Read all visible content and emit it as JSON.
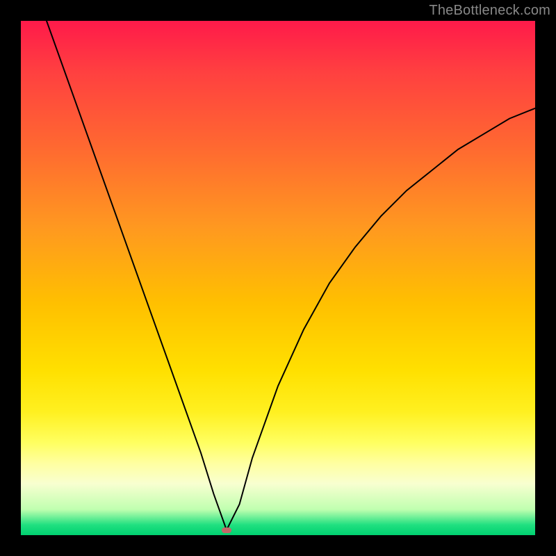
{
  "watermark": "TheBottleneck.com",
  "chart_data": {
    "type": "line",
    "title": "",
    "xlabel": "",
    "ylabel": "",
    "x": [
      0.05,
      0.1,
      0.15,
      0.2,
      0.25,
      0.3,
      0.35,
      0.375,
      0.4,
      0.425,
      0.45,
      0.5,
      0.55,
      0.6,
      0.65,
      0.7,
      0.75,
      0.8,
      0.85,
      0.9,
      0.95,
      1.0
    ],
    "y": [
      1.0,
      0.86,
      0.72,
      0.58,
      0.44,
      0.3,
      0.16,
      0.08,
      0.01,
      0.06,
      0.15,
      0.29,
      0.4,
      0.49,
      0.56,
      0.62,
      0.67,
      0.71,
      0.75,
      0.78,
      0.81,
      0.83
    ],
    "xlim": [
      0,
      1
    ],
    "ylim": [
      0,
      1
    ],
    "minimum_marker": {
      "x": 0.4,
      "y": 0.01
    },
    "gradient_colors_top_to_bottom": [
      "#ff1a4a",
      "#ffe000",
      "#00d070"
    ],
    "notes": "Axis tick labels are not shown in the image; values are normalized 0–1."
  }
}
